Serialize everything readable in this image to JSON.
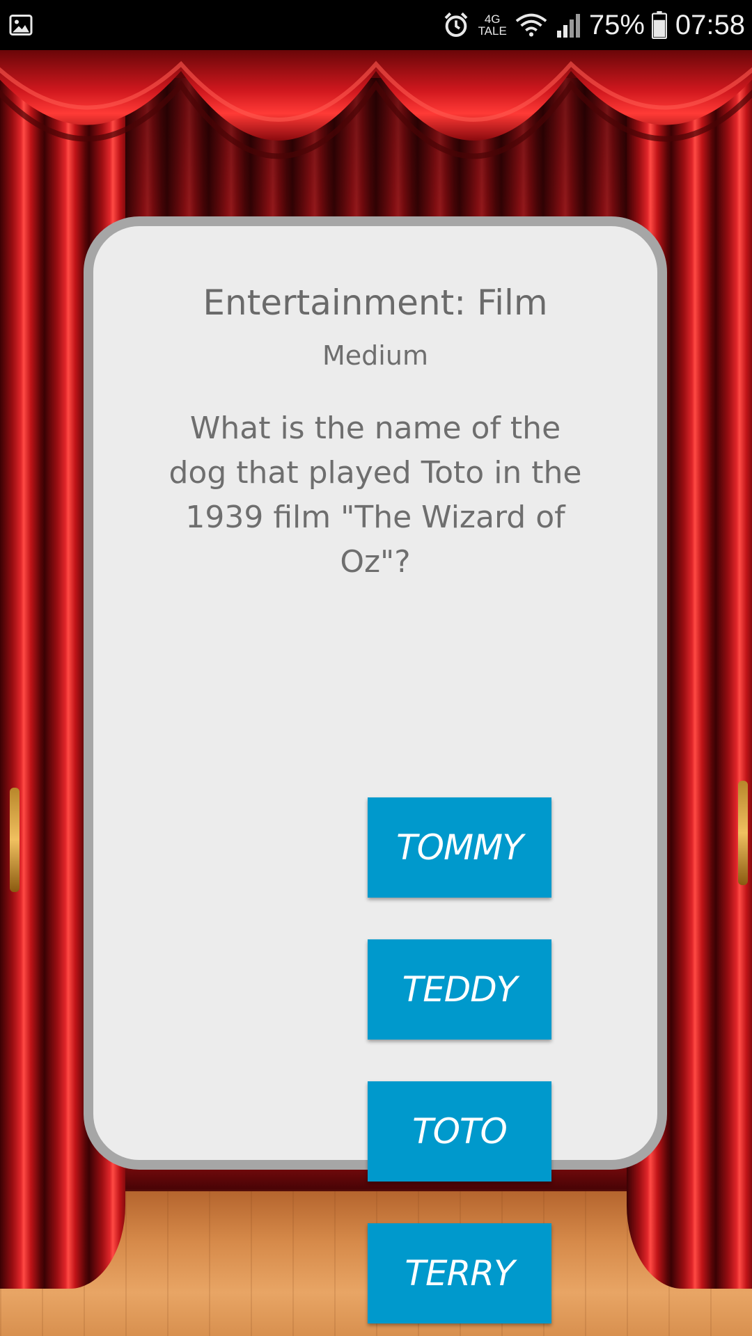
{
  "status_bar": {
    "network_type_top": "4G",
    "network_type_bottom": "TALE",
    "battery_percent": "75%",
    "time": "07:58",
    "icons": [
      "gallery-icon",
      "alarm-icon",
      "wifi-icon",
      "signal-icon",
      "battery-icon"
    ]
  },
  "quiz": {
    "category": "Entertainment: Film",
    "difficulty": "Medium",
    "question": "What is the name of the dog that played Toto in the 1939 film \"The Wizard of Oz\"?",
    "answers": [
      {
        "label": "TOMMY"
      },
      {
        "label": "TEDDY"
      },
      {
        "label": "TOTO"
      },
      {
        "label": "TERRY"
      }
    ]
  },
  "colors": {
    "card_background": "#ececec",
    "card_border": "#a6a6a6",
    "text_gray": "#6e6e6e",
    "button_blue": "#0099cc",
    "curtain_red": "#c8161c"
  }
}
